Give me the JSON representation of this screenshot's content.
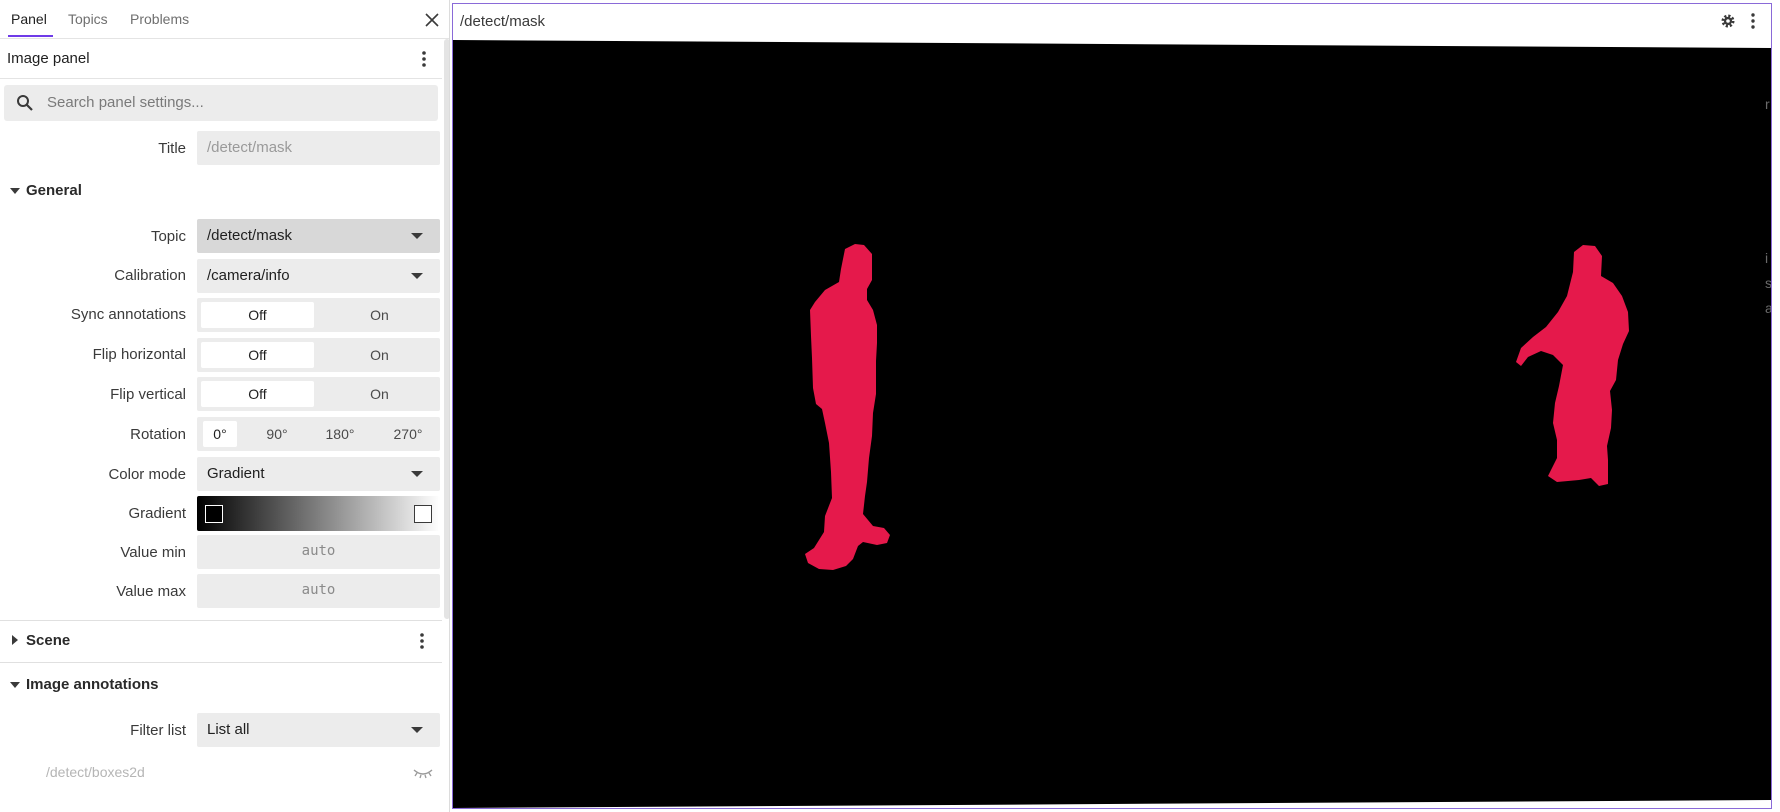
{
  "sidebar": {
    "tabs": [
      {
        "label": "Panel",
        "active": true
      },
      {
        "label": "Topics",
        "active": false
      },
      {
        "label": "Problems",
        "active": false
      }
    ],
    "panel_title": "Image panel",
    "search_placeholder": "Search panel settings...",
    "title_field": {
      "label": "Title",
      "placeholder": "/detect/mask"
    },
    "sections": {
      "general": "General",
      "scene": "Scene",
      "image_annotations": "Image annotations"
    },
    "general": {
      "topic": {
        "label": "Topic",
        "value": "/detect/mask"
      },
      "calibration": {
        "label": "Calibration",
        "value": "/camera/info"
      },
      "sync_annotations": {
        "label": "Sync annotations",
        "off": "Off",
        "on": "On",
        "selected": "Off"
      },
      "flip_horizontal": {
        "label": "Flip horizontal",
        "off": "Off",
        "on": "On",
        "selected": "Off"
      },
      "flip_vertical": {
        "label": "Flip vertical",
        "off": "Off",
        "on": "On",
        "selected": "Off"
      },
      "rotation": {
        "label": "Rotation",
        "options": [
          "0°",
          "90°",
          "180°",
          "270°"
        ],
        "selected": "0°"
      },
      "color_mode": {
        "label": "Color mode",
        "value": "Gradient"
      },
      "gradient": {
        "label": "Gradient",
        "start_color": "#000000",
        "end_color": "#ffffff"
      },
      "value_min": {
        "label": "Value min",
        "placeholder": "auto"
      },
      "value_max": {
        "label": "Value max",
        "placeholder": "auto"
      }
    },
    "image_annotations": {
      "filter_list": {
        "label": "Filter list",
        "value": "List all"
      },
      "topics": [
        {
          "name": "/detect/boxes2d",
          "visible": false
        }
      ]
    }
  },
  "image_panel": {
    "title": "/detect/mask",
    "overflow_glyphs": [
      "r",
      "i",
      "s",
      "a"
    ]
  },
  "colors": {
    "accent": "#6f3be8",
    "panel_border": "#8a6ad8",
    "mask_color": "#e5194b",
    "image_background": "#000000"
  }
}
